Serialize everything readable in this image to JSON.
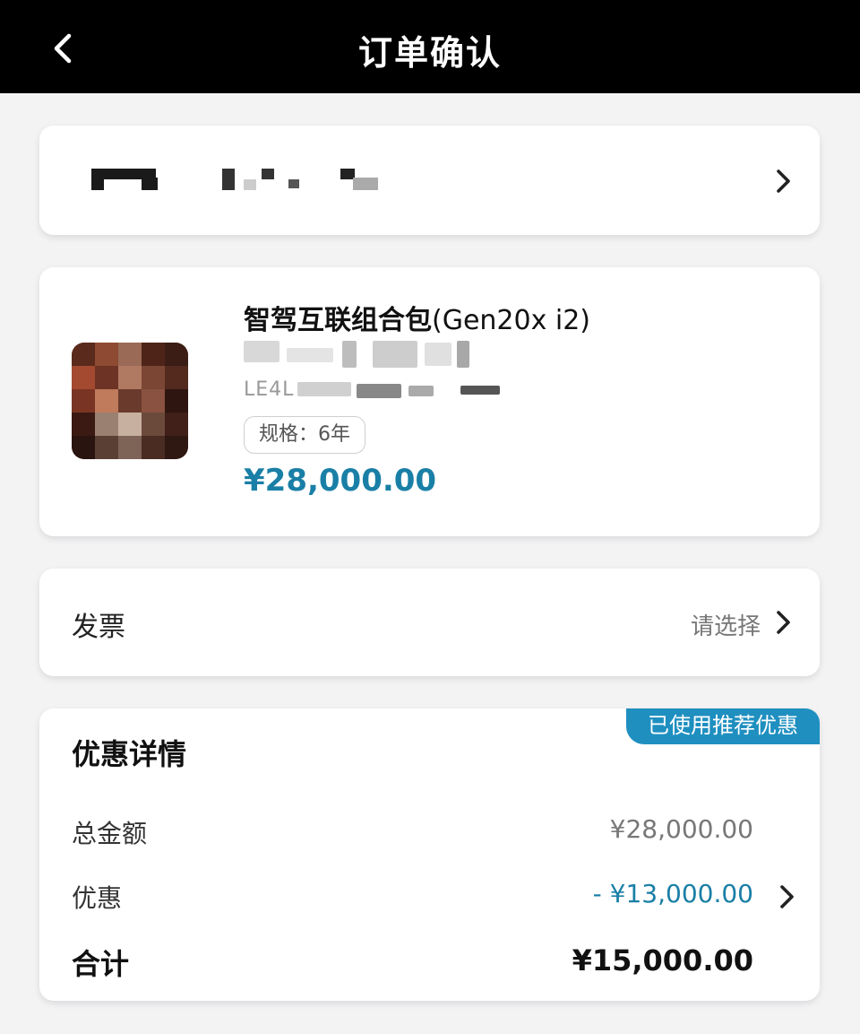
{
  "header": {
    "title": "订单确认",
    "back_icon": "chevron-left-icon"
  },
  "product": {
    "title_cn": "智驾互联组合包",
    "title_en": "(Gen20x i2)",
    "vin_partial": "LE4L",
    "spec_label": "规格",
    "spec_separator": "：",
    "spec_value": "6年",
    "price": "¥28,000.00"
  },
  "invoice": {
    "label": "发票",
    "value": "请选择"
  },
  "discount": {
    "badge": "已使用推荐优惠",
    "title": "优惠详情",
    "rows": [
      {
        "label": "总金额",
        "value": "¥28,000.00"
      },
      {
        "label": "优惠",
        "value": "- ¥13,000.00"
      },
      {
        "label": "合计",
        "value": "¥15,000.00"
      }
    ]
  },
  "colors": {
    "accent": "#1a7fa6",
    "badge": "#1f8fc0",
    "header_bg": "#000000",
    "page_bg": "#f3f3f4"
  }
}
